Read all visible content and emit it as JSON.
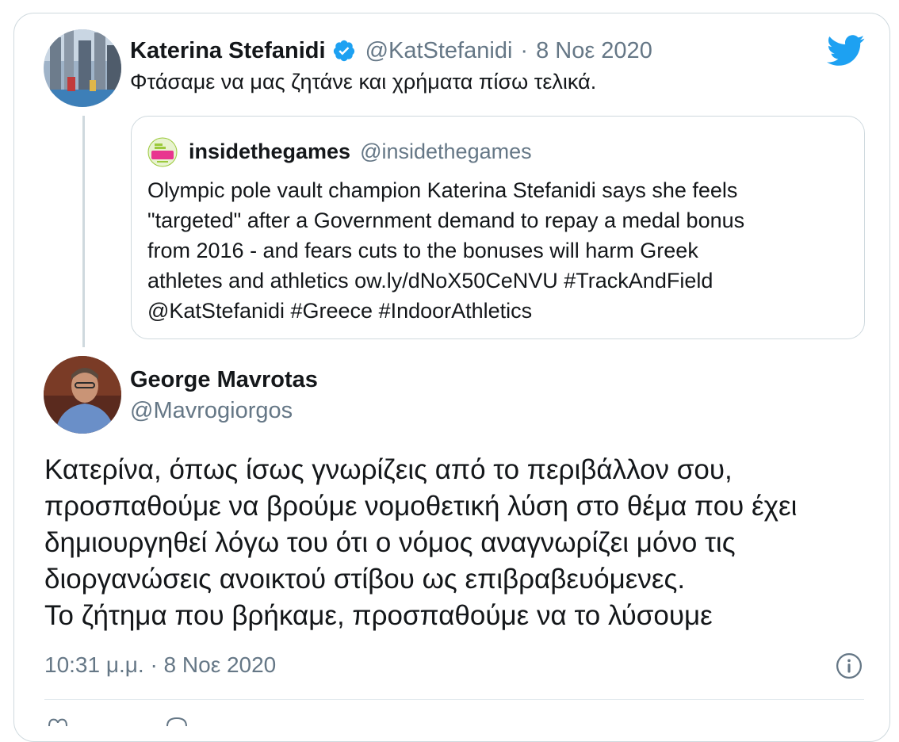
{
  "tweet": {
    "author_name": "Katerina Stefanidi",
    "author_handle": "@KatStefanidi",
    "separator": "·",
    "date": "8 Νοε 2020",
    "text": "Φτάσαμε να μας ζητάνε και χρήματα πίσω τελικά."
  },
  "quoted_tweet": {
    "author_name": "insidethegames",
    "author_handle": "@insidethegames",
    "lines": [
      "Olympic pole vault champion Katerina Stefanidi says she feels",
      "\"targeted\" after a Government demand to repay a medal bonus",
      "from 2016 - and fears cuts to the bonuses will harm Greek",
      "athletes and athletics ow.ly/dNoX50CeNVU #TrackAndField",
      "@KatStefanidi #Greece #IndoorAthletics"
    ]
  },
  "reply": {
    "author_name": "George Mavrotas",
    "author_handle": "@Mavrogiorgos",
    "lines": [
      "Κατερίνα, όπως ίσως γνωρίζεις από το περιβάλλον σου,",
      "προσπαθούμε να βρούμε νομοθετική λύση στο θέμα που έχει",
      "δημιουργηθεί λόγω του ότι ο νόμος αναγνωρίζει μόνο τις",
      "διοργανώσεις ανοικτού στίβου ως επιβραβευόμενες.",
      "Το ζήτημα που βρήκαμε, προσπαθούμε να το λύσουμε"
    ],
    "timestamp": "10:31 μ.μ. · 8 Νοε 2020"
  },
  "icons": {
    "brand": "twitter-bird-icon",
    "verified": "verified-badge-icon",
    "info": "info-icon"
  },
  "colors": {
    "twitter_blue": "#1da1f2",
    "text": "#14171a",
    "secondary_text": "#657786",
    "border": "#cfd9de"
  }
}
